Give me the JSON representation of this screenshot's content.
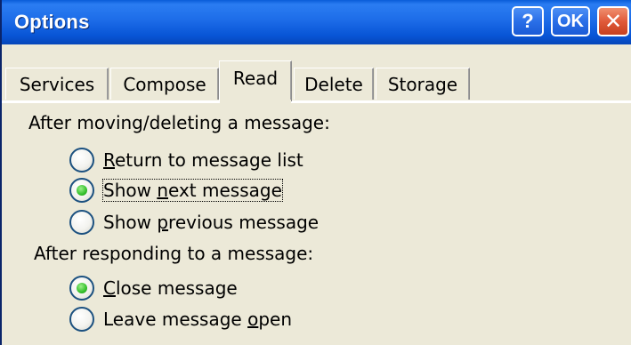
{
  "window": {
    "title": "Options",
    "help_label": "?",
    "ok_label": "OK",
    "close_glyph": "✕"
  },
  "tabs": [
    {
      "label": "Services",
      "active": false
    },
    {
      "label": "Compose",
      "active": false
    },
    {
      "label": "Read",
      "active": true
    },
    {
      "label": "Delete",
      "active": false
    },
    {
      "label": "Storage",
      "active": false
    }
  ],
  "group_after_move": {
    "heading": "After moving/deleting a message:",
    "options": [
      {
        "pre": "",
        "key": "R",
        "post": "eturn to message list",
        "checked": false
      },
      {
        "pre": "Show ",
        "key": "n",
        "post": "ext message",
        "checked": true
      },
      {
        "pre": "Show ",
        "key": "p",
        "post": "revious message",
        "checked": false
      }
    ]
  },
  "group_after_respond": {
    "heading": "After responding to a message:",
    "options": [
      {
        "pre": "",
        "key": "C",
        "post": "lose message",
        "checked": true
      },
      {
        "pre": "Leave message ",
        "key": "o",
        "post": "pen",
        "checked": false
      }
    ]
  },
  "colors": {
    "titlebar": "#1d6ce8",
    "close_button": "#e15a3a",
    "dialog_bg": "#ece9d8",
    "radio_selected": "#34c02c"
  }
}
